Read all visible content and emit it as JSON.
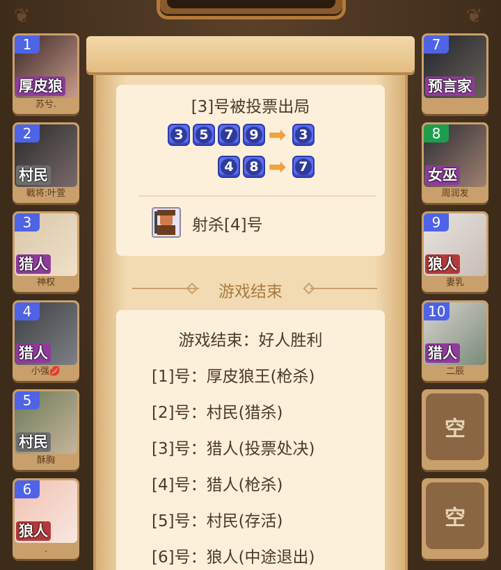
{
  "vote": {
    "title": "[3]号被投票出局",
    "groups": [
      {
        "voters": [
          "3",
          "5",
          "7",
          "9"
        ],
        "target": "3"
      },
      {
        "voters": [
          "4",
          "8"
        ],
        "target": "7"
      }
    ]
  },
  "action": {
    "text": "射杀[4]号"
  },
  "end_section": {
    "header": "游戏结束"
  },
  "result": {
    "title": "游戏结束：好人胜利",
    "lines": [
      "[1]号：厚皮狼王(枪杀)",
      "[2]号：村民(猎杀)",
      "[3]号：猎人(投票处决)",
      "[4]号：猎人(枪杀)",
      "[5]号：村民(存活)",
      "[6]号：狼人(中途退出)"
    ]
  },
  "players_left": [
    {
      "num": "1",
      "role": "厚皮狼",
      "nick": "苏兮.",
      "colors": [
        "#3a2a28",
        "#c99a8a"
      ]
    },
    {
      "num": "2",
      "role": "村民",
      "nick": "戰将:叶萱",
      "colors": [
        "#2a2a2a",
        "#7a6a6a"
      ]
    },
    {
      "num": "3",
      "role": "猎人",
      "nick": "神权",
      "colors": [
        "#d9c7a9",
        "#f0e0c8"
      ]
    },
    {
      "num": "4",
      "role": "猎人",
      "nick": "小强💋",
      "colors": [
        "#3d3f42",
        "#7d8086"
      ]
    },
    {
      "num": "5",
      "role": "村民",
      "nick": "酥胸",
      "colors": [
        "#6a7a5a",
        "#c8b59a"
      ]
    },
    {
      "num": "6",
      "role": "狼人",
      "nick": ".",
      "colors": [
        "#f0c0b0",
        "#f8e8e0"
      ]
    }
  ],
  "players_right": [
    {
      "num": "7",
      "role": "预言家",
      "nick": "",
      "colors": [
        "#22262e",
        "#6a6058"
      ]
    },
    {
      "num": "8",
      "role": "女巫",
      "nick": "周润发",
      "colors": [
        "#2a2e34",
        "#a08070"
      ]
    },
    {
      "num": "9",
      "role": "狼人",
      "nick": "妻乳",
      "colors": [
        "#e8e4e0",
        "#c8bdb5"
      ]
    },
    {
      "num": "10",
      "role": "猎人",
      "nick": "二辰",
      "colors": [
        "#d8d4d0",
        "#7a8a78"
      ]
    },
    {
      "empty": "空"
    },
    {
      "empty": "空"
    }
  ]
}
